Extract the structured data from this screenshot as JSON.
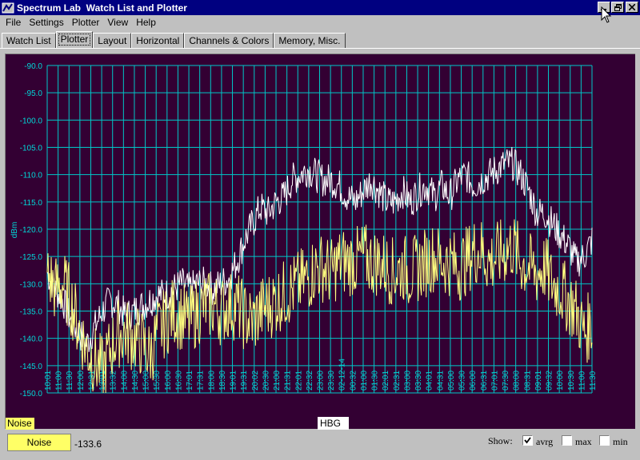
{
  "window": {
    "title": "Spectrum Lab  Watch List and Plotter",
    "minimize_label": "_",
    "restore_icon": "restore-icon",
    "close_label": "×"
  },
  "menu": [
    "File",
    "Settings",
    "Plotter",
    "View",
    "Help"
  ],
  "tabs": [
    {
      "label": "Watch List",
      "active": false
    },
    {
      "label": "Plotter",
      "active": true
    },
    {
      "label": "Layout",
      "active": false
    },
    {
      "label": "Horizontal",
      "active": false
    },
    {
      "label": "Channels & Colors",
      "active": false
    },
    {
      "label": "Memory, Misc.",
      "active": false
    }
  ],
  "plot": {
    "background": "#330033",
    "grid_color": "#00c8c8",
    "axis_label_color": "#00d8d8",
    "channel_label": "Noise",
    "marker_label": "HBG"
  },
  "bottom": {
    "channel_button": "Noise",
    "channel_value": "-133.6",
    "show_label": "Show:",
    "avrg_label": "avrg",
    "avrg_checked": true,
    "max_label": "max",
    "max_checked": false,
    "min_label": "min",
    "min_checked": false
  },
  "chart_data": {
    "type": "line",
    "title": "",
    "xlabel": "",
    "ylabel": "dBm",
    "ylim": [
      -150,
      -90
    ],
    "y_ticks": [
      "-90.0",
      "-95.0",
      "-100.0",
      "-105.0",
      "-110.0",
      "-115.0",
      "-120.0",
      "-125.0",
      "-130.0",
      "-135.0",
      "-140.0",
      "-145.0",
      "-150.0"
    ],
    "x": [
      "10:01",
      "11:00",
      "11:30",
      "12:00",
      "12:31",
      "13:01",
      "13:32",
      "14:00",
      "14:30",
      "15:00",
      "15:30",
      "16:00",
      "16:30",
      "17:01",
      "17:31",
      "18:00",
      "18:30",
      "19:01",
      "19:31",
      "20:02",
      "20:30",
      "21:00",
      "21:31",
      "22:01",
      "22:32",
      "23:00",
      "23:30",
      "02-12-14",
      "00:32",
      "01:00",
      "01:30",
      "02:01",
      "02:31",
      "03:00",
      "03:30",
      "04:01",
      "04:31",
      "05:00",
      "05:30",
      "06:00",
      "06:31",
      "07:01",
      "07:30",
      "08:00",
      "08:31",
      "09:01",
      "09:32",
      "10:00",
      "10:30",
      "11:00",
      "11:30"
    ],
    "grid": true,
    "series": [
      {
        "color": "#ffffff",
        "values": [
          -128,
          -131,
          -133,
          -137,
          -139,
          -141,
          -138,
          -135,
          -133,
          -134,
          -136,
          -135,
          -134,
          -133,
          -132,
          -132,
          -131,
          -130,
          -131,
          -130,
          -130,
          -131,
          -130,
          -129,
          -126,
          -122,
          -119,
          -116,
          -117,
          -115,
          -114,
          -111,
          -110,
          -109,
          -110,
          -111,
          -111,
          -112,
          -114,
          -115,
          -113,
          -111,
          -113,
          -115,
          -115,
          -113,
          -115,
          -113,
          -112,
          -114,
          -112,
          -114,
          -111,
          -110,
          -112,
          -111,
          -110,
          -109,
          -108,
          -108,
          -110,
          -113,
          -117,
          -117,
          -119,
          -121,
          -123,
          -126,
          -125,
          -122
        ]
      },
      {
        "color": "#ffff80",
        "values": [
          -128,
          -131,
          -130,
          -133,
          -138,
          -142,
          -144,
          -146,
          -142,
          -139,
          -139,
          -140,
          -141,
          -143,
          -139,
          -137,
          -135,
          -136,
          -137,
          -135,
          -134,
          -134,
          -135,
          -134,
          -134,
          -136,
          -137,
          -135,
          -134,
          -133,
          -132,
          -131,
          -130,
          -129,
          -127,
          -127,
          -128,
          -126,
          -126,
          -126,
          -125,
          -126,
          -126,
          -127,
          -128,
          -127,
          -128,
          -127,
          -126,
          -125,
          -126,
          -126,
          -127,
          -126,
          -124,
          -124,
          -126,
          -125,
          -124,
          -123,
          -126,
          -127,
          -128,
          -127,
          -130,
          -131,
          -133,
          -135,
          -139,
          -137
        ]
      }
    ]
  }
}
